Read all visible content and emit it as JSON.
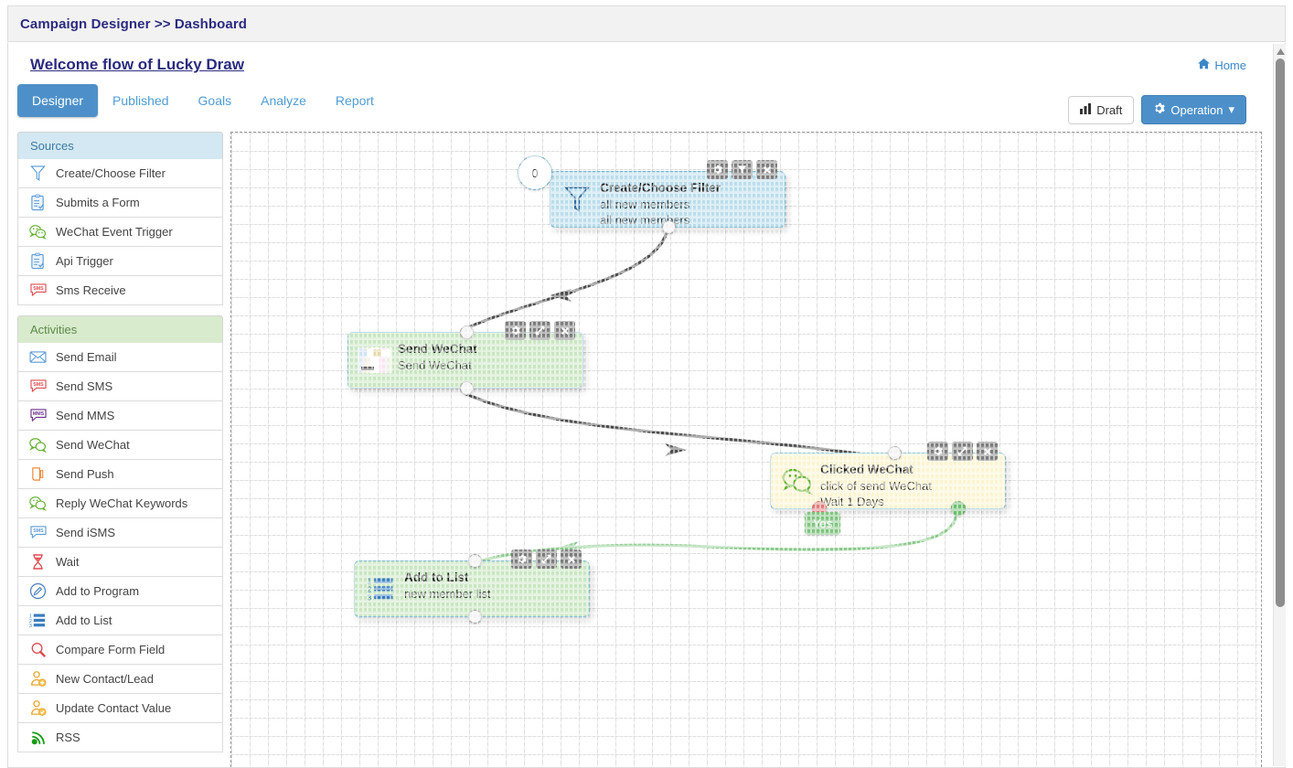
{
  "breadcrumb": {
    "text": "Campaign Designer >> Dashboard"
  },
  "header": {
    "flow_title": "Welcome flow of Lucky Draw",
    "home_label": "Home",
    "home_icon": "home-icon"
  },
  "tabs": [
    {
      "label": "Designer",
      "active": true
    },
    {
      "label": "Published",
      "active": false
    },
    {
      "label": "Goals",
      "active": false
    },
    {
      "label": "Analyze",
      "active": false
    },
    {
      "label": "Report",
      "active": false
    }
  ],
  "actions": {
    "draft": {
      "label": "Draft",
      "icon": "bar-chart-icon"
    },
    "operation": {
      "label": "Operation",
      "icon": "gear-icon",
      "caret": "▾",
      "color": "#4d90c9"
    }
  },
  "sidebar": {
    "sources": {
      "title": "Sources",
      "items": [
        {
          "label": "Create/Choose Filter",
          "icon": "funnel-icon"
        },
        {
          "label": "Submits a Form",
          "icon": "form-icon"
        },
        {
          "label": "WeChat Event Trigger",
          "icon": "wechat-icon"
        },
        {
          "label": "Api Trigger",
          "icon": "form-icon"
        },
        {
          "label": "Sms Receive",
          "icon": "sms-icon"
        }
      ]
    },
    "activities": {
      "title": "Activities",
      "items": [
        {
          "label": "Send Email",
          "icon": "envelope-icon"
        },
        {
          "label": "Send SMS",
          "icon": "sms-icon"
        },
        {
          "label": "Send MMS",
          "icon": "mms-icon"
        },
        {
          "label": "Send WeChat",
          "icon": "wechat-icon"
        },
        {
          "label": "Send Push",
          "icon": "push-icon"
        },
        {
          "label": "Reply WeChat Keywords",
          "icon": "wechat-icon"
        },
        {
          "label": "Send iSMS",
          "icon": "isms-icon"
        },
        {
          "label": "Wait",
          "icon": "hourglass-icon"
        },
        {
          "label": "Add to Program",
          "icon": "pencil-circle-icon"
        },
        {
          "label": "Add to List",
          "icon": "numbered-list-icon"
        },
        {
          "label": "Compare Form Field",
          "icon": "magnifier-icon"
        },
        {
          "label": "New Contact/Lead",
          "icon": "user-add-icon"
        },
        {
          "label": "Update Contact Value",
          "icon": "user-edit-icon"
        },
        {
          "label": "RSS",
          "icon": "rss-icon"
        }
      ]
    }
  },
  "canvas": {
    "nodes": [
      {
        "id": "filter",
        "title": "Create/Choose Filter",
        "line2": "all new members",
        "line3": "all new members",
        "badge": "0",
        "icon": "funnel-icon",
        "color": "#b9ddec",
        "tools": [
          "gear-icon",
          "funnel-icon",
          "close-icon"
        ]
      },
      {
        "id": "send-wechat",
        "title": "Send WeChat",
        "line2": "Send WeChat",
        "line3": "",
        "icon": "thumbnail-icon",
        "color": "#c8e6c0",
        "tools": [
          "gear-icon",
          "expand-icon",
          "close-icon"
        ]
      },
      {
        "id": "clicked-wechat",
        "title": "Clicked WeChat",
        "line2": "click of send WeChat",
        "line3": "Wait 1 Days",
        "icon": "wechat-icon",
        "color": "#fbf4cf",
        "tools": [
          "gear-icon",
          "expand-icon",
          "close-icon"
        ]
      },
      {
        "id": "add-to-list",
        "title": "Add to List",
        "line2": "new member list",
        "line3": "",
        "icon": "numbered-list-icon",
        "color": "#c8e6c0",
        "tools": [
          "gear-icon",
          "expand-icon",
          "close-icon"
        ]
      }
    ],
    "wire_labels": [
      {
        "text": "Yes",
        "color": "#7fc37f"
      }
    ]
  }
}
